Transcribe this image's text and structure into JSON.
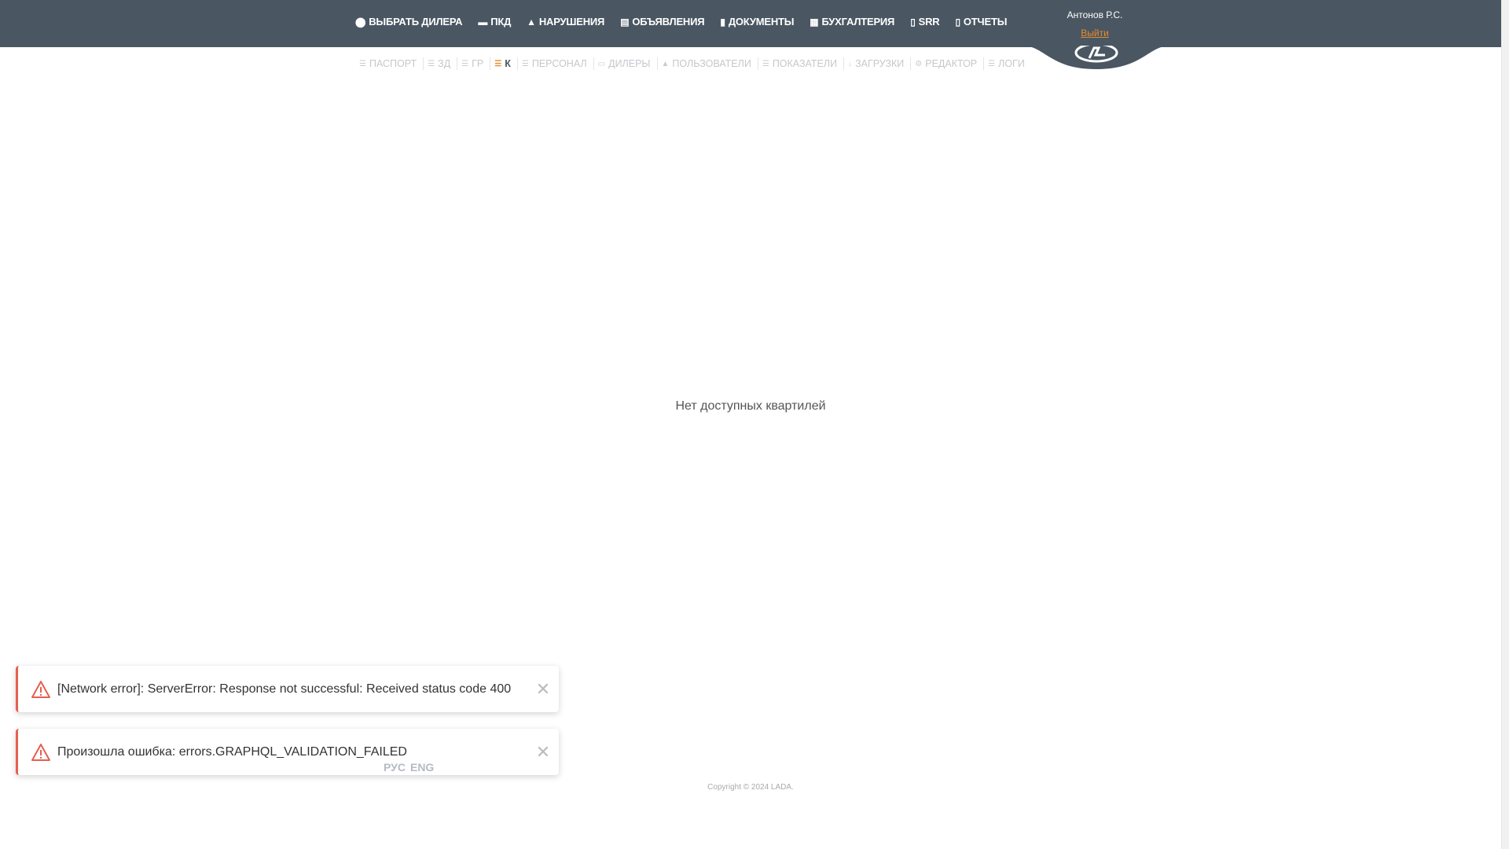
{
  "top_nav": [
    {
      "label": "ВЫБРАТЬ ДИЛЕРА",
      "icon": "map-pin-icon"
    },
    {
      "label": "ПКД",
      "icon": "folder-icon"
    },
    {
      "label": "НАРУШЕНИЯ",
      "icon": "warning-icon"
    },
    {
      "label": "ОБЪЯВЛЕНИЯ",
      "icon": "announcement-icon"
    },
    {
      "label": "ДОКУМЕНТЫ",
      "icon": "document-icon"
    },
    {
      "label": "БУХГАЛТЕРИЯ",
      "icon": "calculator-icon"
    },
    {
      "label": "SRR",
      "icon": "report-icon"
    },
    {
      "label": "ОТЧЕТЫ",
      "icon": "report-icon"
    }
  ],
  "user": {
    "name": "Антонов Р.С.",
    "logout": "Выйти"
  },
  "sub_nav": [
    {
      "label": "ПАСПОРТ",
      "icon": "list-icon"
    },
    {
      "label": "ЗД",
      "icon": "list-icon"
    },
    {
      "label": "ГР",
      "icon": "list-icon"
    },
    {
      "label": "К",
      "icon": "list-icon",
      "active": true
    },
    {
      "label": "ПЕРСОНАЛ",
      "icon": "list-icon"
    },
    {
      "label": "ДИЛЕРЫ",
      "icon": "car-icon"
    },
    {
      "label": "ПОЛЬЗОВАТЕЛИ",
      "icon": "user-icon"
    },
    {
      "label": "ПОКАЗАТЕЛИ",
      "icon": "list-icon"
    },
    {
      "label": "ЗАГРУЗКИ",
      "icon": "download-icon"
    },
    {
      "label": "РЕДАКТОР",
      "icon": "gear-icon"
    },
    {
      "label": "ЛОГИ",
      "icon": "list-icon"
    }
  ],
  "main": {
    "empty_message": "Нет доступных квартилей"
  },
  "footer": {
    "lang_ru": "РУС",
    "lang_en": "ENG",
    "copyright": "Copyright © 2024 LADA."
  },
  "toasts": [
    {
      "message": "[Network error]: ServerError: Response not successful: Received status code 400"
    },
    {
      "message": "Произошла ошибка: errors.GRAPHQL_VALIDATION_FAILED"
    }
  ],
  "colors": {
    "header": "#4a5762",
    "accent": "#e8892b",
    "error": "#e5604f"
  }
}
